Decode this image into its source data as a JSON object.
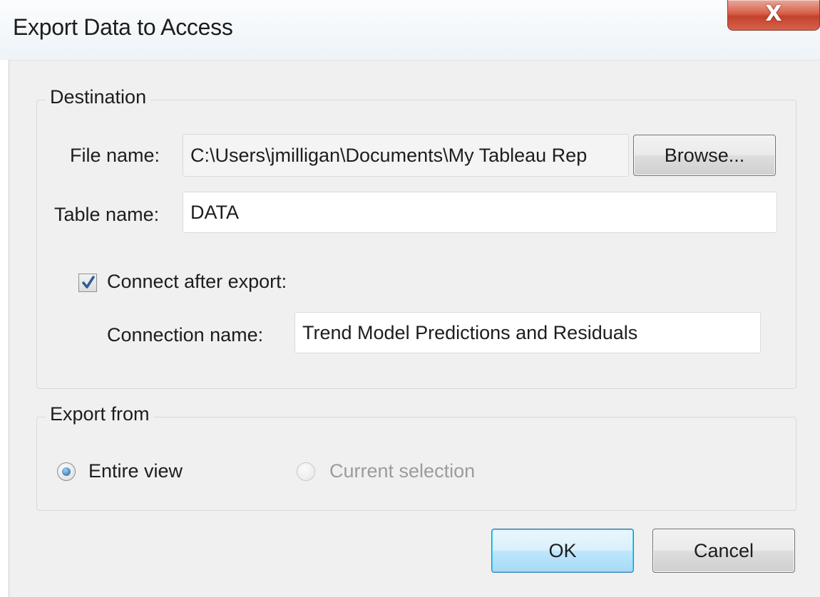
{
  "window": {
    "title": "Export Data to Access",
    "close_label": "X"
  },
  "destination": {
    "legend": "Destination",
    "file_name_label": "File name:",
    "file_name_value": "C:\\Users\\jmilligan\\Documents\\My Tableau Rep",
    "browse_label": "Browse...",
    "table_name_label": "Table name:",
    "table_name_value": "DATA",
    "connect_after_export_label": "Connect after export:",
    "connect_after_export_checked": true,
    "connection_name_label": "Connection name:",
    "connection_name_value": "Trend Model Predictions and Residuals"
  },
  "export_from": {
    "legend": "Export from",
    "entire_view_label": "Entire view",
    "entire_view_selected": true,
    "current_selection_label": "Current selection",
    "current_selection_enabled": false
  },
  "footer": {
    "ok_label": "OK",
    "cancel_label": "Cancel"
  },
  "colors": {
    "dialog_background": "#f0f0f0",
    "close_button": "#c4422c",
    "default_button_accent": "#3c7fb1"
  },
  "icons": {
    "close": "close-icon",
    "checkmark": "checkmark-icon"
  }
}
